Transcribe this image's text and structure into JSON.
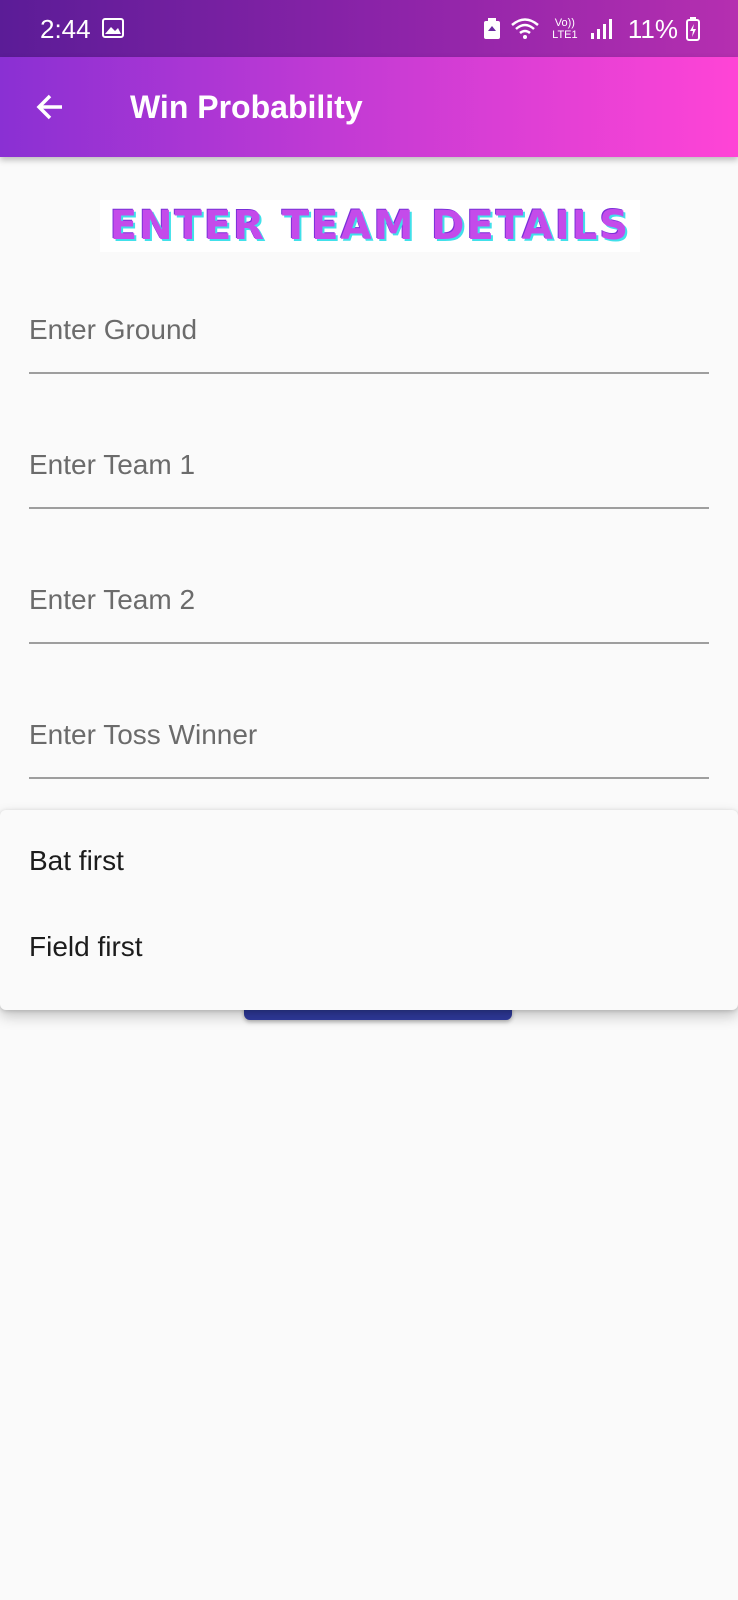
{
  "status_bar": {
    "time": "2:44",
    "network_label": "Vo)) LTE1",
    "battery": "11%"
  },
  "app_bar": {
    "title": "Win Probability"
  },
  "form": {
    "heading": "ENTER TEAM DETAILS",
    "ground_placeholder": "Enter Ground",
    "team1_placeholder": "Enter Team 1",
    "team2_placeholder": "Enter Team 2",
    "toss_placeholder": "Enter Toss Winner"
  },
  "dropdown": {
    "options": [
      "Bat first",
      "Field first"
    ]
  },
  "colors": {
    "app_bar_gradient_start": "#8a30d3",
    "app_bar_gradient_end": "#ff44d6",
    "heading_text": "#c44bea",
    "button": "#2f3a9c"
  },
  "icons": {
    "back": "arrow-left-icon",
    "gallery": "image-icon",
    "recycle": "recycle-icon",
    "wifi": "wifi-icon",
    "signal": "signal-icon",
    "battery": "battery-icon"
  }
}
